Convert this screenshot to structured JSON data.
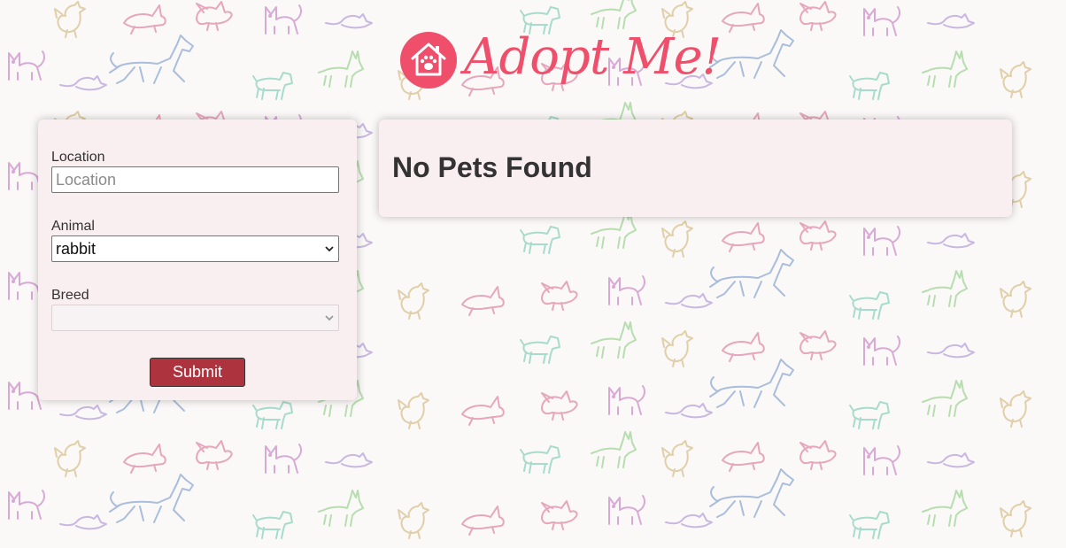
{
  "brand": {
    "logo_text": "Adopt Me!",
    "logo_color": "#ef4f6b"
  },
  "search_form": {
    "location": {
      "label": "Location",
      "placeholder": "Location",
      "value": ""
    },
    "animal": {
      "label": "Animal",
      "selected": "rabbit"
    },
    "breed": {
      "label": "Breed",
      "selected": "",
      "disabled": true
    },
    "submit_label": "Submit",
    "button_color": "#ad343e"
  },
  "results": {
    "message": "No Pets Found"
  },
  "background": {
    "pattern_animals": [
      "cat-icon",
      "rabbit-icon",
      "bird-icon",
      "dog-icon",
      "horse-icon",
      "mouse-icon",
      "chicken-icon",
      "goat-icon"
    ]
  }
}
